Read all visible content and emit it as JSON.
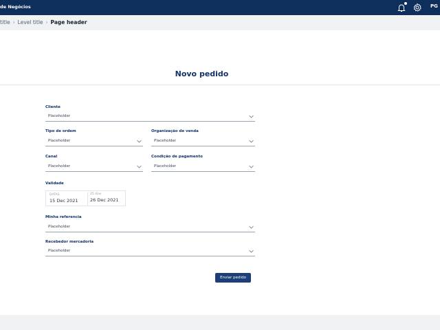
{
  "header": {
    "app_title": "de Negócios",
    "avatar_initials": "PG",
    "icons": [
      "bell-icon",
      "gear-icon"
    ]
  },
  "breadcrumb": {
    "items": [
      "title",
      "Level title"
    ],
    "current": "Page header"
  },
  "page": {
    "title": "Novo pedido"
  },
  "form": {
    "cliente": {
      "label": "Cliente",
      "value": "Placeholder"
    },
    "tipo_ordem": {
      "label": "Tipo de ordem",
      "value": "Placeholder"
    },
    "organizacao_venda": {
      "label": "Organização de venda",
      "value": "Placeholder"
    },
    "canal": {
      "label": "Canal",
      "value": "Placeholder"
    },
    "condicao_pagamento": {
      "label": "Condição de pagamento",
      "value": "Placeholder"
    },
    "validade": {
      "label": "Validade",
      "start_caption": "DATAS",
      "start_value": "15 Dec 2021",
      "end_caption": "25 dias",
      "end_value": "26 Dec 2021"
    },
    "minha_referencia": {
      "label": "Minha referencia",
      "value": "Placeholder"
    },
    "recebedor_mercadoria": {
      "label": "Recebedor mercadoria",
      "value": "Placeholder"
    },
    "submit_label": "Enviar pedido"
  },
  "colors": {
    "topbar": "#0e2e5c",
    "accent": "#12306a",
    "button": "#1c3f7a"
  }
}
